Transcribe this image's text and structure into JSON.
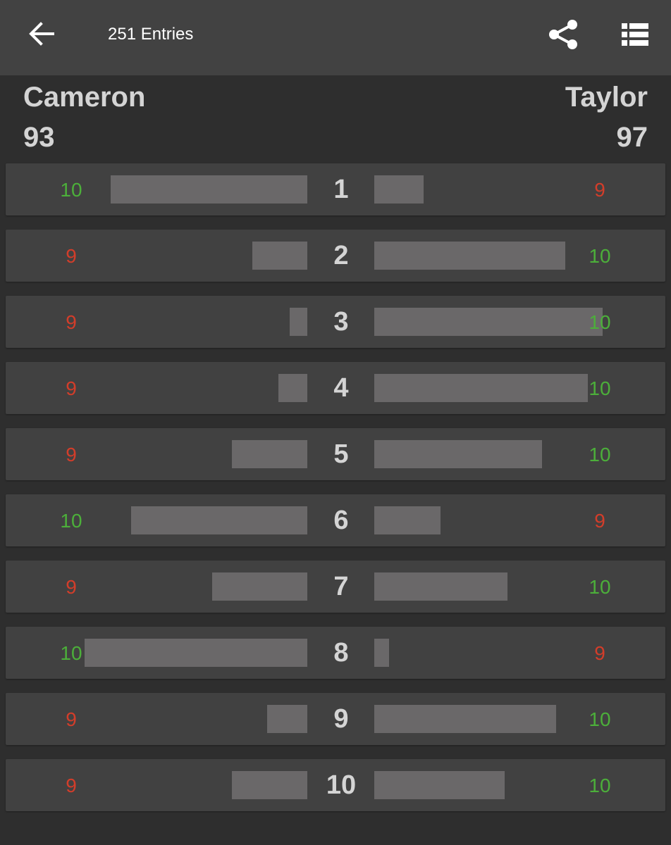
{
  "appbar": {
    "title": "251 Entries",
    "back_icon": "arrow-left-icon",
    "share_icon": "share-icon",
    "list_icon": "list-view-icon"
  },
  "players": {
    "left": {
      "name": "Cameron",
      "total": "93"
    },
    "right": {
      "name": "Taylor",
      "total": "97"
    }
  },
  "colors": {
    "win": "#4caf3a",
    "lose": "#d23d2a",
    "bar": "#6a6869",
    "row": "#414141",
    "background": "#2e2e2e",
    "appbar": "#424242"
  },
  "rounds": [
    {
      "round": "1",
      "left_score": "10",
      "right_score": "9",
      "left_bar": 0.68,
      "right_bar": 0.17
    },
    {
      "round": "2",
      "left_score": "9",
      "right_score": "10",
      "left_bar": 0.19,
      "right_bar": 0.66
    },
    {
      "round": "3",
      "left_score": "9",
      "right_score": "10",
      "left_bar": 0.06,
      "right_bar": 0.79
    },
    {
      "round": "4",
      "left_score": "9",
      "right_score": "10",
      "left_bar": 0.1,
      "right_bar": 0.74
    },
    {
      "round": "5",
      "left_score": "9",
      "right_score": "10",
      "left_bar": 0.26,
      "right_bar": 0.58
    },
    {
      "round": "6",
      "left_score": "10",
      "right_score": "9",
      "left_bar": 0.61,
      "right_bar": 0.23
    },
    {
      "round": "7",
      "left_score": "9",
      "right_score": "10",
      "left_bar": 0.33,
      "right_bar": 0.46
    },
    {
      "round": "8",
      "left_score": "10",
      "right_score": "9",
      "left_bar": 0.77,
      "right_bar": 0.05
    },
    {
      "round": "9",
      "left_score": "9",
      "right_score": "10",
      "left_bar": 0.14,
      "right_bar": 0.63
    },
    {
      "round": "10",
      "left_score": "9",
      "right_score": "10",
      "left_bar": 0.26,
      "right_bar": 0.45
    }
  ]
}
